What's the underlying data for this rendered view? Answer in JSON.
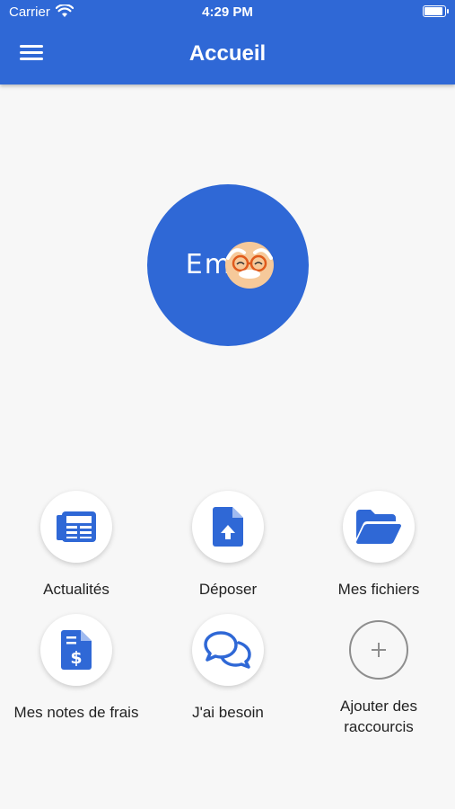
{
  "status_bar": {
    "carrier": "Carrier",
    "time": "4:29 PM"
  },
  "header": {
    "title": "Accueil",
    "menu_icon": "hamburger-menu-icon"
  },
  "logo": {
    "text": "Emi    e",
    "brand_color": "#2f68d6"
  },
  "shortcuts": [
    {
      "label": "Actualités",
      "icon": "newspaper-icon"
    },
    {
      "label": "Déposer",
      "icon": "file-upload-icon"
    },
    {
      "label": "Mes fichiers",
      "icon": "folder-open-icon"
    },
    {
      "label": "Mes notes de frais",
      "icon": "invoice-dollar-icon"
    },
    {
      "label": "J'ai besoin",
      "icon": "chat-bubbles-icon"
    },
    {
      "label": "Ajouter des raccourcis",
      "icon": "plus-icon"
    }
  ],
  "colors": {
    "accent": "#2f68d6",
    "background": "#f7f7f7",
    "text": "#222222"
  }
}
